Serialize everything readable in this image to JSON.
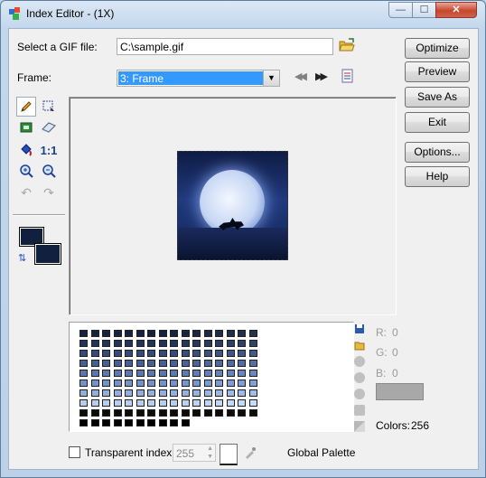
{
  "window": {
    "title": "Index Editor - (1X)",
    "minimize_glyph": "—",
    "maximize_glyph": "☐",
    "close_glyph": "✕"
  },
  "file": {
    "label": "Select a GIF file:",
    "value": "C:\\sample.gif"
  },
  "frame": {
    "label": "Frame:",
    "selected": "3: Frame"
  },
  "buttons": {
    "optimize": "Optimize",
    "preview": "Preview",
    "save_as": "Save As",
    "exit": "Exit",
    "options": "Options...",
    "help": "Help"
  },
  "tools": {
    "actual_size": "1:1"
  },
  "palette": {
    "rgb_r_label": "R:",
    "rgb_r_value": "0",
    "rgb_g_label": "G:",
    "rgb_g_value": "0",
    "rgb_b_label": "B:",
    "rgb_b_value": "0",
    "colors_label": "Colors:",
    "colors_value": "256",
    "scope_label": "Global Palette"
  },
  "transparent": {
    "label": "Transparent index",
    "value": "255",
    "checked": false
  },
  "colors": {
    "foreground": "#10203e",
    "background": "#10203e",
    "selection": "#3399ff"
  }
}
